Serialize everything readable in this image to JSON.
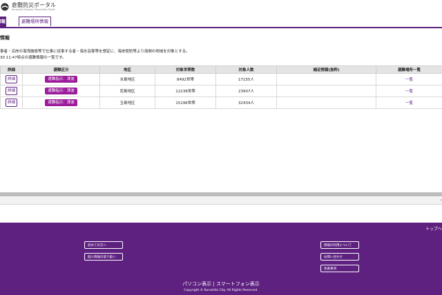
{
  "header": {
    "site_title": "倉敷防災ポータル",
    "site_subtitle": "Kurashiki Disaster Prevention Portal"
  },
  "tabs": [
    {
      "label": "情報"
    },
    {
      "label": "避難場所情報"
    }
  ],
  "main": {
    "section_title": "情報",
    "description_line1": "事者・沿岸の港湾施設等で仕事に従事する者・海水浴客等を想定に、海岸堤防等より海側の地域を対象とする。",
    "description_line2": "30 11:47時点の避難情報の一覧です。"
  },
  "table": {
    "headers": [
      "詳細",
      "避難区分",
      "地区",
      "対象世帯数",
      "対象人数",
      "補足情報(抜粋)",
      "避難場所一覧"
    ],
    "rows": [
      {
        "detail": "詳細",
        "category": "避難指示：津波",
        "district": "水島地区",
        "households": "8492世帯",
        "people": "17155人",
        "note": "",
        "shelter_link": "一覧"
      },
      {
        "detail": "詳細",
        "category": "避難指示：津波",
        "district": "児島地区",
        "households": "12238世帯",
        "people": "23907人",
        "note": "",
        "shelter_link": "一覧"
      },
      {
        "detail": "詳細",
        "category": "避難指示：津波",
        "district": "玉島地区",
        "households": "15196世帯",
        "people": "32434人",
        "note": "",
        "shelter_link": "一覧"
      }
    ]
  },
  "footer": {
    "to_top": "トップへ",
    "left_links": [
      "初めての方へ",
      "個人情報の取り扱い"
    ],
    "right_links": [
      "情報の利用について",
      "お問い合わせ",
      "免責事項"
    ],
    "view_switch": "パソコン表示 | スマートフォン表示",
    "copyright": "Copyright © Kurashiki City. All Rights Reserved."
  },
  "colors": {
    "brand": "#5e2180",
    "badge": "#9b1b9b"
  }
}
